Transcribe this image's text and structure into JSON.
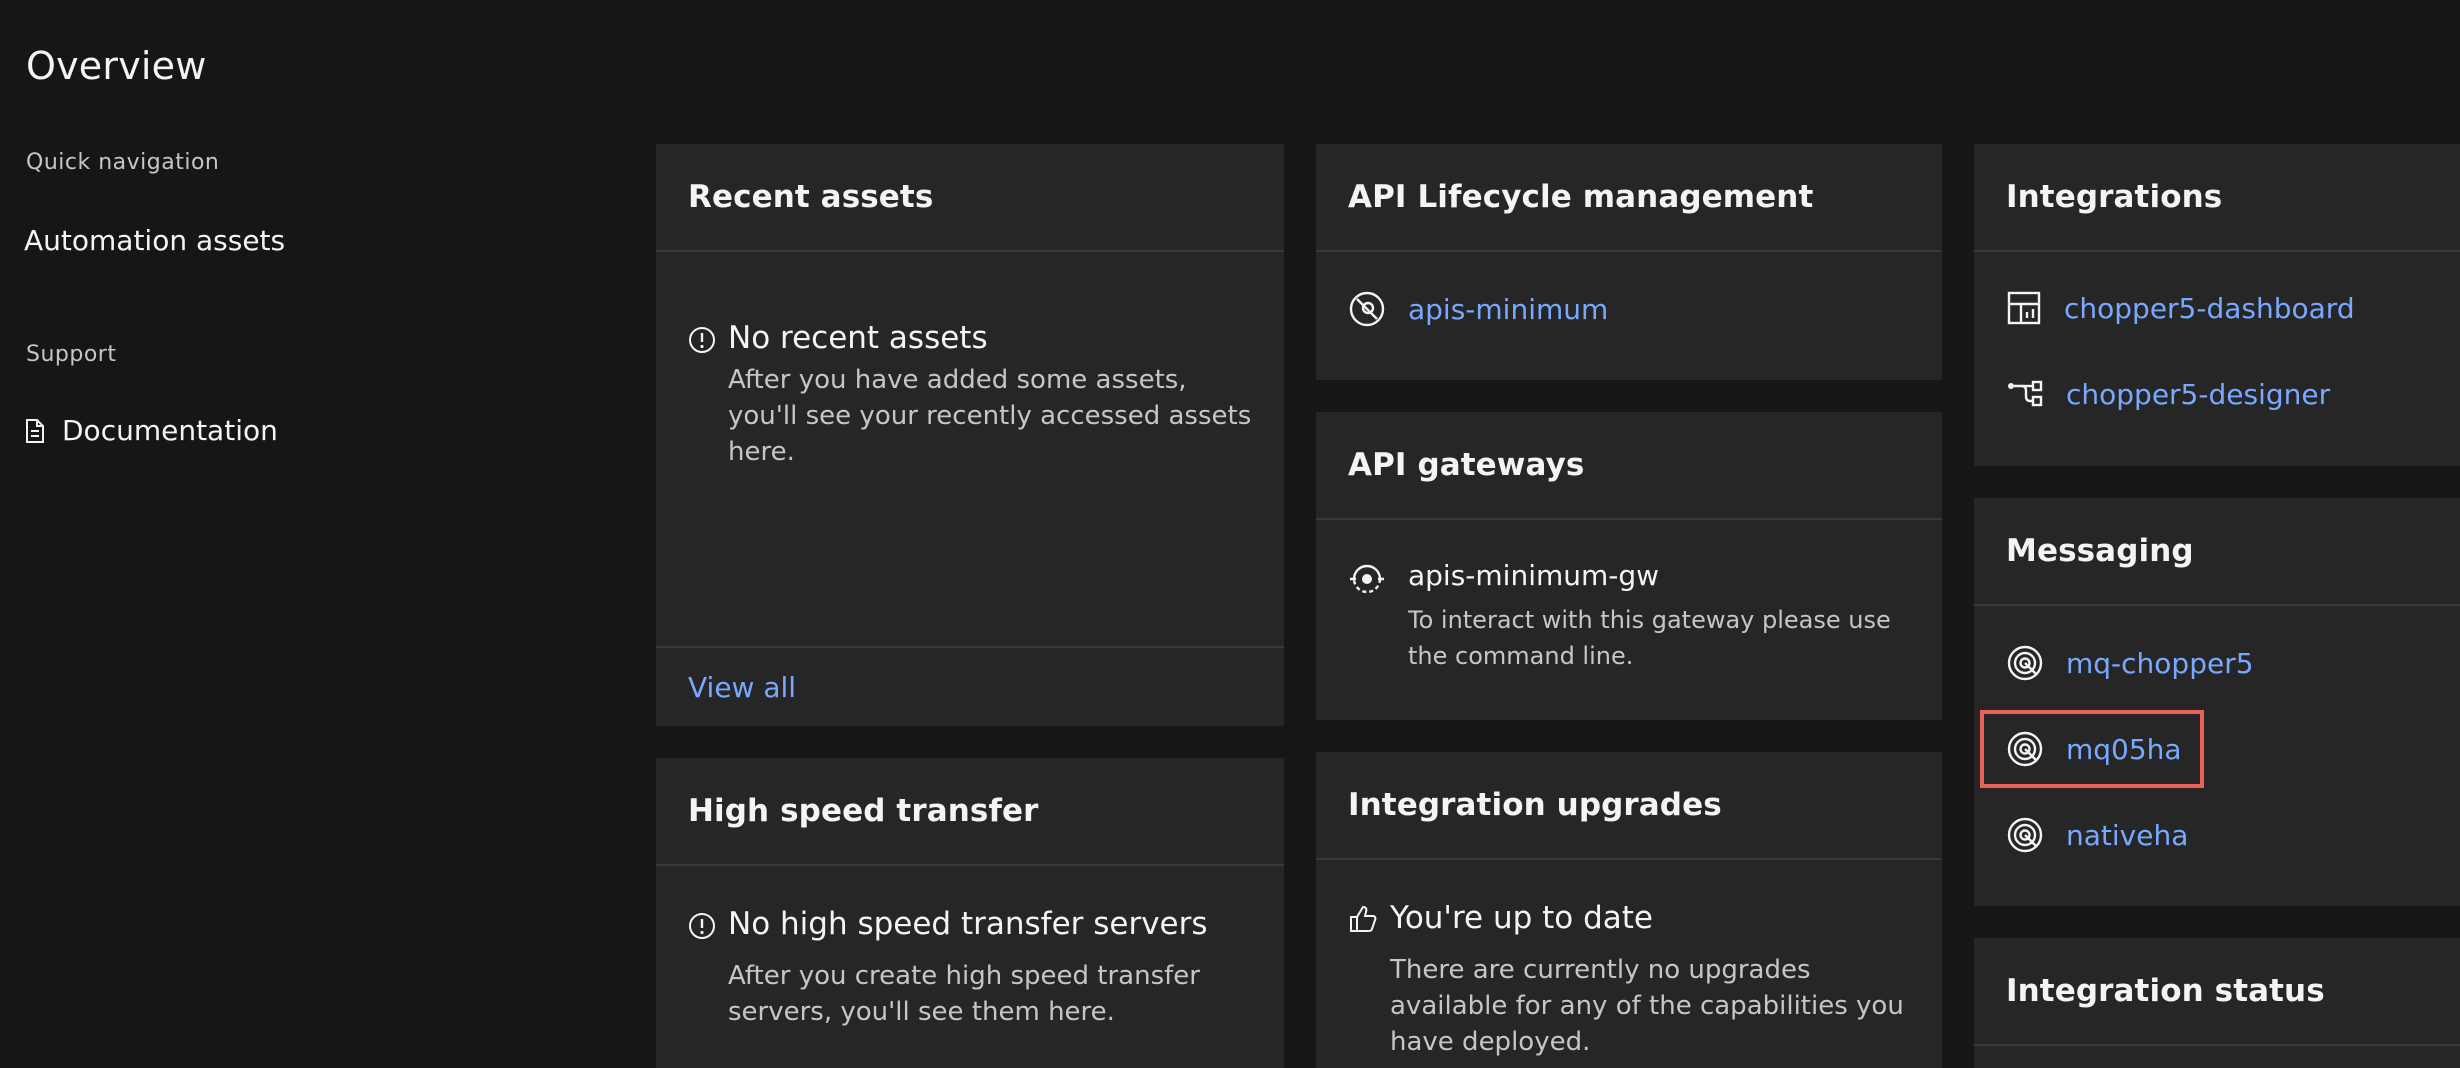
{
  "page": {
    "title": "Overview"
  },
  "nav": {
    "quick_heading": "Quick navigation",
    "automation_assets": "Automation assets",
    "support_heading": "Support",
    "documentation": "Documentation",
    "documentation_icon": "document-icon"
  },
  "recent_assets": {
    "title": "Recent assets",
    "empty_title": "No recent assets",
    "empty_body_1": "After you have added some assets,",
    "empty_body_2": "you'll see your recently accessed assets",
    "empty_body_3": "here.",
    "view_all": "View all"
  },
  "high_speed": {
    "title": "High speed transfer",
    "empty_title": "No high speed transfer servers",
    "empty_body_1": "After you create high speed transfer",
    "empty_body_2": "servers, you'll see them here."
  },
  "api_lifecycle": {
    "title": "API Lifecycle management",
    "items": [
      {
        "label": "apis-minimum",
        "icon": "api-icon"
      }
    ]
  },
  "api_gateways": {
    "title": "API gateways",
    "items": [
      {
        "label": "apis-minimum-gw",
        "icon": "gateway-icon",
        "desc_1": "To interact with this gateway please use",
        "desc_2": "the command line."
      }
    ]
  },
  "upgrades": {
    "title": "Integration upgrades",
    "status_title": "You're up to date",
    "status_icon": "thumbs-up-icon",
    "body_1": "There are currently no upgrades",
    "body_2": "available for any of the capabilities you",
    "body_3": "have deployed."
  },
  "integrations": {
    "title": "Integrations",
    "items": [
      {
        "label": "chopper5-dashboard",
        "icon": "dashboard-icon"
      },
      {
        "label": "chopper5-designer",
        "icon": "designer-flow-icon"
      }
    ]
  },
  "messaging": {
    "title": "Messaging",
    "items": [
      {
        "label": "mq-chopper5",
        "icon": "queue-manager-icon"
      },
      {
        "label": "mq05ha",
        "icon": "queue-manager-icon"
      },
      {
        "label": "nativeha",
        "icon": "queue-manager-icon"
      }
    ]
  },
  "integration_status": {
    "title": "Integration status"
  },
  "colors": {
    "link": "#78a9ff",
    "tile": "#262626",
    "background": "#161616",
    "highlight": "#e8625a"
  }
}
